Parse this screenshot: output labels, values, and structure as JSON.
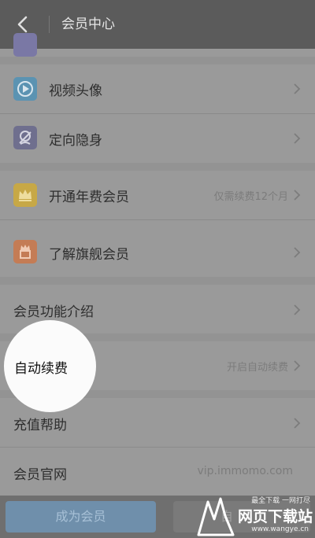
{
  "header": {
    "title": "会员中心"
  },
  "rows": {
    "video_avatar": {
      "label": "视频头像"
    },
    "stealth": {
      "label": "定向隐身"
    },
    "annual": {
      "label": "开通年费会员",
      "value": "仅需续费12个月"
    },
    "flagship": {
      "label": "了解旗舰会员"
    },
    "intro": {
      "label": "会员功能介绍"
    },
    "auto_renew": {
      "label": "自动续费",
      "value": "开启自动续费"
    },
    "recharge_help": {
      "label": "充值帮助"
    },
    "official_site": {
      "label": "会员官网",
      "value": "vip.immomo.com"
    }
  },
  "bottom": {
    "become_member": "成为会员",
    "second_label": "自"
  },
  "watermark": {
    "top": "最全下载 一网打尽",
    "main": "网页下载站",
    "url": "www.wangye.cn"
  },
  "colors": {
    "video_icon": "#5b93b2",
    "stealth_icon": "#6f6f8e",
    "annual_icon": "#c7a846",
    "flagship_icon": "#c47c55",
    "primary_button": "#6f8fab"
  },
  "icons": {
    "back": "chevron-left-icon",
    "video_avatar": "play-icon",
    "stealth": "stealth-icon",
    "annual": "crown-icon",
    "flagship": "crown-box-icon",
    "chevron": "chevron-right-icon"
  }
}
